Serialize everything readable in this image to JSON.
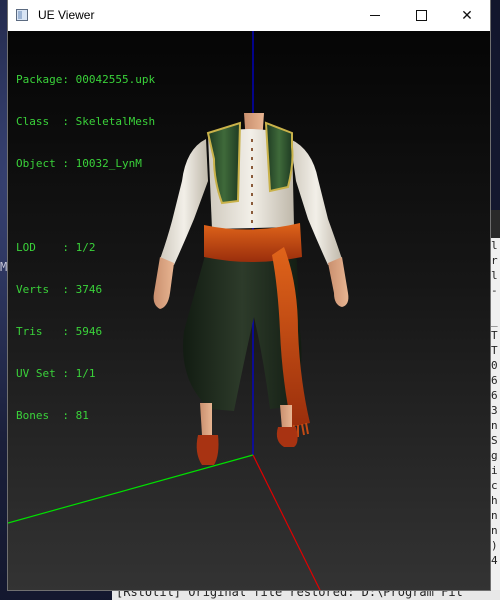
{
  "window": {
    "title": "UE Viewer",
    "controls": {
      "minimize": "—",
      "maximize": "☐",
      "close": "✕"
    }
  },
  "info": {
    "package": "Package: 00042555.upk",
    "class": "Class  : SkeletalMesh",
    "object": "Object : 10032_LynM",
    "lod": "LOD    : 1/2",
    "verts": "Verts  : 3746",
    "tris": "Tris   : 5946",
    "uvset": "UV Set : 1/1",
    "bones": "Bones  : 81"
  },
  "axes": {
    "x_color": "#00e000",
    "y_color": "#e00000",
    "z_color": "#0000e0"
  },
  "background_console": {
    "bottom_line": "[RstUtil] Original file restored: D:\\Program Fil",
    "right_column": "l\nr\nl\n-\n\n_\nT\nT\n0\n6\n6\n3\nn\nS\ng\ni\nc\nh\nn\nn\n)\n4",
    "left_fragment": "M"
  },
  "icons": {
    "app": "window-icon",
    "minimize": "minimize-icon",
    "maximize": "maximize-icon",
    "close": "close-icon"
  }
}
